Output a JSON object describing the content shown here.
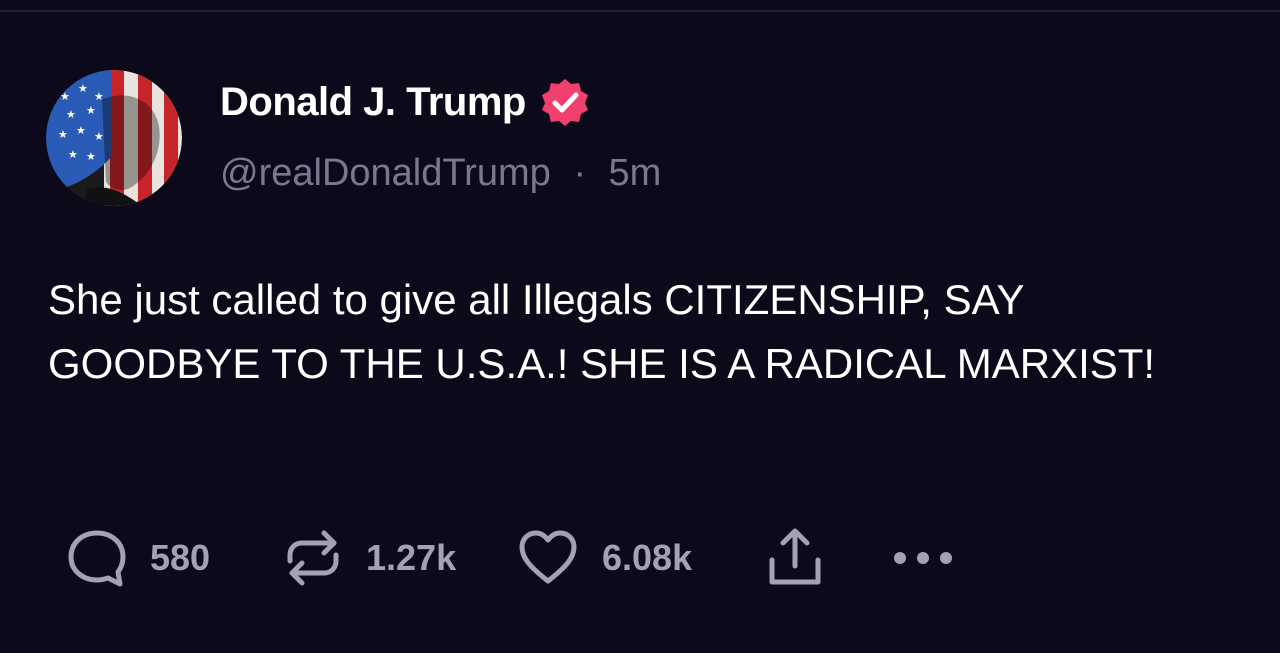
{
  "post": {
    "author": {
      "display_name": "Donald J. Trump",
      "handle": "@realDonaldTrump",
      "separator": "·",
      "time_ago": "5m",
      "avatar_icon": "flag-portrait-avatar",
      "verified_icon": "verified-badge-icon"
    },
    "body": "She just called to give all Illegals CITIZENSHIP, SAY GOODBYE TO THE U.S.A.! SHE IS A RADICAL MARXIST!",
    "actions": {
      "replies": {
        "icon": "reply-icon",
        "count": "580"
      },
      "reposts": {
        "icon": "repost-icon",
        "count": "1.27k"
      },
      "likes": {
        "icon": "heart-icon",
        "count": "6.08k"
      },
      "share": {
        "icon": "share-icon"
      },
      "more": {
        "icon": "more-icon"
      }
    }
  },
  "colors": {
    "background": "#0c0a1a",
    "text_primary": "#ffffff",
    "text_secondary": "#7a7890",
    "action_gray": "#a3a1b5",
    "verified_pink": "#f0406e"
  }
}
